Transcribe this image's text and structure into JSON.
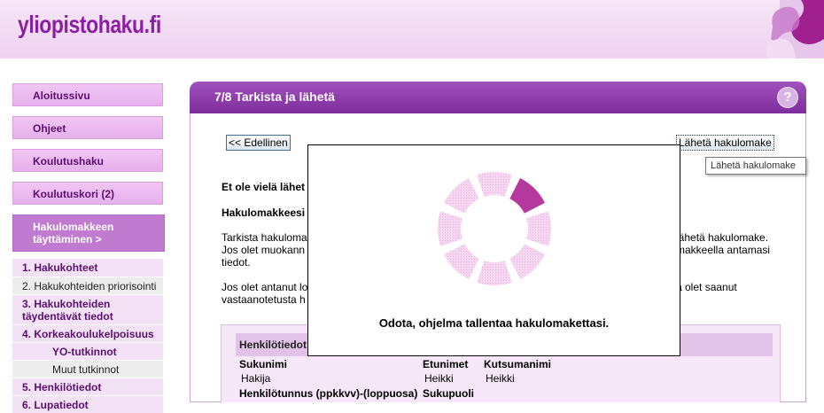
{
  "brand": {
    "logo": "yliopistohaku.fi",
    "accent": "#8a1fa3"
  },
  "sidebar": {
    "buttons": [
      "Aloitussivu",
      "Ohjeet",
      "Koulutushaku",
      "Koulutuskori (2)"
    ],
    "active": "Hakulomakkeen täyttäminen >",
    "items": [
      "1. Hakukohteet",
      "2. Hakukohteiden priorisointi",
      "3. Hakukohteiden täydentävät tiedot",
      "4. Korkeakoulukelpoisuus",
      "YO-tutkinnot",
      "Muut tutkinnot",
      "5. Henkilötiedot",
      "6. Lupatiedot"
    ]
  },
  "panel": {
    "title": "7/8 Tarkista ja lähetä",
    "help": "?",
    "prev_button": "<< Edellinen",
    "send_button": "Lähetä hakulomake",
    "tooltip": "Lähetä hakulomake",
    "line1": "Et ole vielä lähet",
    "line2": "Hakulomakkeesi",
    "p1_l1": "Tarkista hakuloma",
    "p1_l1r": "lähetä hakulomake.",
    "p1_l2": "Jos olet muokann",
    "p1_l2r": "makkeella antamasi",
    "p1_l3": "tiedot.",
    "p2_l1": "Jos olet antanut lo",
    "p2_l1r": "ä olet saanut",
    "p2_l2": "vastaanotetusta h",
    "section": "Henkilötiedot",
    "fields": {
      "surname_label": "Sukunimi",
      "surname": "Hakija",
      "first_label": "Etunimet",
      "first": "Heikki",
      "call_label": "Kutsumanimi",
      "call": "Heikki",
      "ssn_label": "Henkilötunnus (ppkkvv)-(loppuosa)",
      "gender_label": "Sukupuoli"
    }
  },
  "modal": {
    "message": "Odota, ohjelma tallentaa hakulomakettasi.",
    "spinner_active": "#b5399e",
    "spinner_inactive": "#f3c8ee"
  }
}
